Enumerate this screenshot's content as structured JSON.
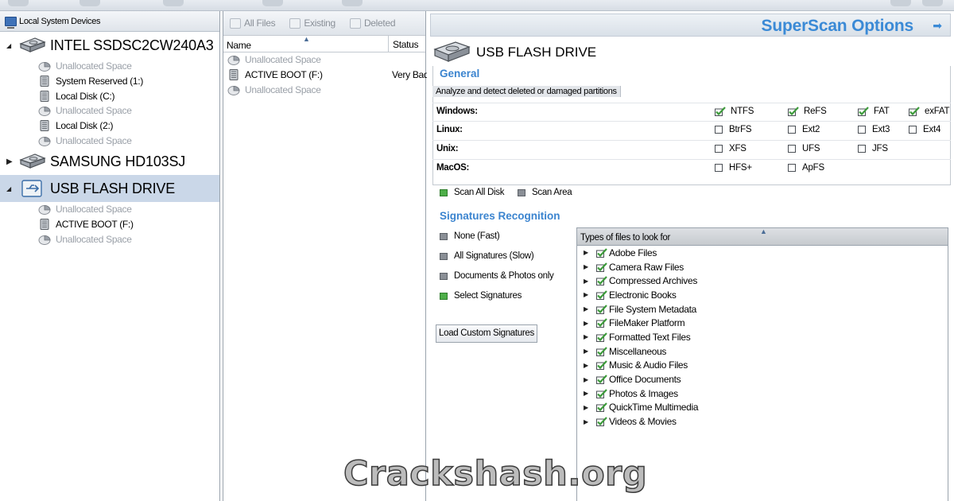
{
  "left": {
    "header": "Local System Devices",
    "drives": [
      {
        "name": "INTEL SSDSC2CW240A3",
        "expanded": true,
        "selected": false,
        "type": "hdd",
        "partitions": [
          {
            "label": "Unallocated Space",
            "muted": true
          },
          {
            "label": "System Reserved (1:)",
            "muted": false
          },
          {
            "label": "Local Disk (C:)",
            "muted": false
          },
          {
            "label": "Unallocated Space",
            "muted": true
          },
          {
            "label": "Local Disk (2:)",
            "muted": false
          },
          {
            "label": "Unallocated Space",
            "muted": true
          }
        ]
      },
      {
        "name": "SAMSUNG HD103SJ",
        "expanded": false,
        "selected": false,
        "type": "hdd",
        "partitions": []
      },
      {
        "name": "USB FLASH DRIVE",
        "expanded": true,
        "selected": true,
        "type": "usb",
        "partitions": [
          {
            "label": "Unallocated Space",
            "muted": true
          },
          {
            "label": "ACTIVE BOOT (F:)",
            "muted": false
          },
          {
            "label": "Unallocated Space",
            "muted": true
          }
        ]
      }
    ]
  },
  "middle": {
    "toolbar": {
      "all_files": "All Files",
      "existing": "Existing",
      "deleted": "Deleted"
    },
    "columns": {
      "name": "Name",
      "status": "Status"
    },
    "rows": [
      {
        "name": "Unallocated Space",
        "status": "",
        "muted": true
      },
      {
        "name": "ACTIVE BOOT (F:)",
        "status": "Very Bad",
        "muted": false
      },
      {
        "name": "Unallocated Space",
        "status": "",
        "muted": true
      }
    ]
  },
  "right": {
    "header_title": "SuperScan Options",
    "device_title": "USB FLASH DRIVE",
    "general": {
      "title": "General",
      "analyze_label": "Analyze and detect deleted or damaged partitions",
      "os_rows": [
        {
          "label": "Windows:",
          "fs": [
            {
              "name": "NTFS",
              "checked": true
            },
            {
              "name": "ReFS",
              "checked": true
            },
            {
              "name": "FAT",
              "checked": true
            },
            {
              "name": "exFAT",
              "checked": true
            }
          ]
        },
        {
          "label": "Linux:",
          "fs": [
            {
              "name": "BtrFS",
              "checked": false
            },
            {
              "name": "Ext2",
              "checked": false
            },
            {
              "name": "Ext3",
              "checked": false
            },
            {
              "name": "Ext4",
              "checked": false
            }
          ]
        },
        {
          "label": "Unix:",
          "fs": [
            {
              "name": "XFS",
              "checked": false
            },
            {
              "name": "UFS",
              "checked": false
            },
            {
              "name": "JFS",
              "checked": false
            }
          ]
        },
        {
          "label": "MacOS:",
          "fs": [
            {
              "name": "HFS+",
              "checked": false
            },
            {
              "name": "ApFS",
              "checked": false
            }
          ]
        }
      ],
      "scan_all_disk": "Scan All Disk",
      "scan_area": "Scan Area"
    },
    "signatures": {
      "title": "Signatures Recognition",
      "options": [
        {
          "label": "None (Fast)",
          "selected": false
        },
        {
          "label": "All Signatures (Slow)",
          "selected": false
        },
        {
          "label": "Documents & Photos only",
          "selected": false
        },
        {
          "label": "Select Signatures",
          "selected": true
        }
      ],
      "load_button": "Load Custom Signatures",
      "types_header": "Types of files to look for",
      "types": [
        "Adobe Files",
        "Camera Raw Files",
        "Compressed Archives",
        "Electronic Books",
        "File System Metadata",
        "FileMaker Platform",
        "Formatted Text Files",
        "Miscellaneous",
        "Music & Audio Files",
        "Office Documents",
        "Photos & Images",
        "QuickTime Multimedia",
        "Videos & Movies"
      ]
    }
  },
  "watermark": "Crackshash.org",
  "colors": {
    "accent": "#3b8ad6",
    "selected_row": "#cad7e8",
    "check_green": "#3c9a3a",
    "radio_green": "#4dae48"
  }
}
